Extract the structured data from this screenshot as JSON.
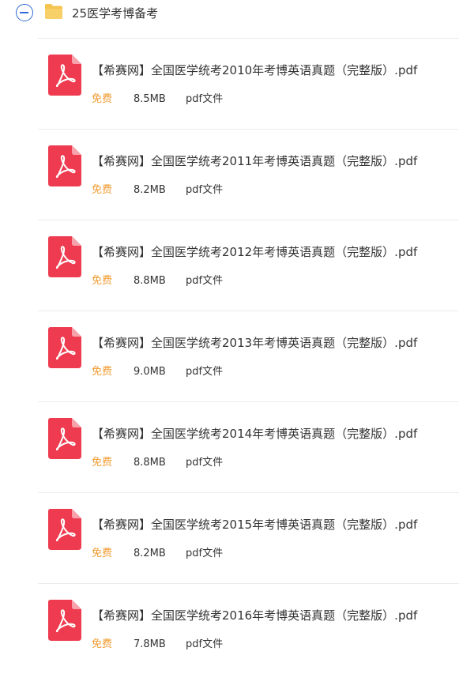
{
  "folder": {
    "name": "25医学考博备考",
    "expanded": true
  },
  "files": [
    {
      "title": "【希赛网】全国医学统考2010年考博英语真题（完整版）.pdf",
      "price": "免费",
      "size": "8.5MB",
      "type": "pdf文件",
      "icon": "pdf-file-icon"
    },
    {
      "title": "【希赛网】全国医学统考2011年考博英语真题（完整版）.pdf",
      "price": "免费",
      "size": "8.2MB",
      "type": "pdf文件",
      "icon": "pdf-file-icon"
    },
    {
      "title": "【希赛网】全国医学统考2012年考博英语真题（完整版）.pdf",
      "price": "免费",
      "size": "8.8MB",
      "type": "pdf文件",
      "icon": "pdf-file-icon"
    },
    {
      "title": "【希赛网】全国医学统考2013年考博英语真题（完整版）.pdf",
      "price": "免费",
      "size": "9.0MB",
      "type": "pdf文件",
      "icon": "pdf-file-icon"
    },
    {
      "title": "【希赛网】全国医学统考2014年考博英语真题（完整版）.pdf",
      "price": "免费",
      "size": "8.8MB",
      "type": "pdf文件",
      "icon": "pdf-file-icon"
    },
    {
      "title": "【希赛网】全国医学统考2015年考博英语真题（完整版）.pdf",
      "price": "免费",
      "size": "8.2MB",
      "type": "pdf文件",
      "icon": "pdf-file-icon"
    },
    {
      "title": "【希赛网】全国医学统考2016年考博英语真题（完整版）.pdf",
      "price": "免费",
      "size": "7.8MB",
      "type": "pdf文件",
      "icon": "pdf-file-icon"
    }
  ],
  "colors": {
    "accent_blue": "#2d6ad6",
    "folder_yellow": "#f5c44e",
    "pdf_red": "#ee3b4f",
    "free_orange": "#f19b31"
  }
}
